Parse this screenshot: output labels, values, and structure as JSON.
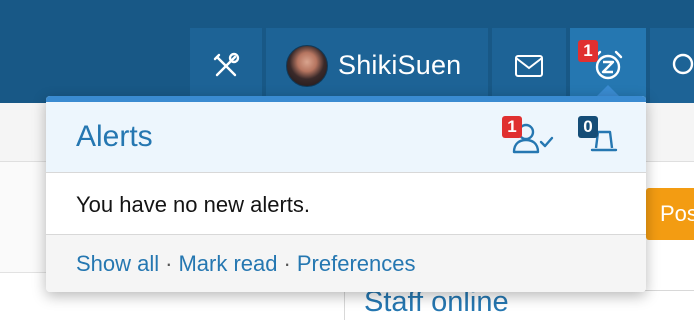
{
  "navbar": {
    "username": "ShikiSuen",
    "alerts_badge": "1",
    "colors": {
      "bar": "#185886",
      "tab": "#1d6396",
      "active_tab": "#2577b1"
    }
  },
  "background": {
    "post_button_label": "Pos",
    "sidebar_title": "Staff online"
  },
  "alerts_menu": {
    "title": "Alerts",
    "followers_badge": "1",
    "reactions_badge": "0",
    "empty_message": "You have no new alerts.",
    "footer": {
      "show_all": "Show all",
      "mark_read": "Mark read",
      "preferences": "Preferences",
      "separator": "·"
    }
  },
  "icons": {
    "tools": "tools-icon",
    "inbox": "envelope-icon",
    "alerts": "alarm-clock-icon",
    "search": "search-icon",
    "followers": "user-check-icon",
    "reactions": "reaction-bell-icon"
  }
}
